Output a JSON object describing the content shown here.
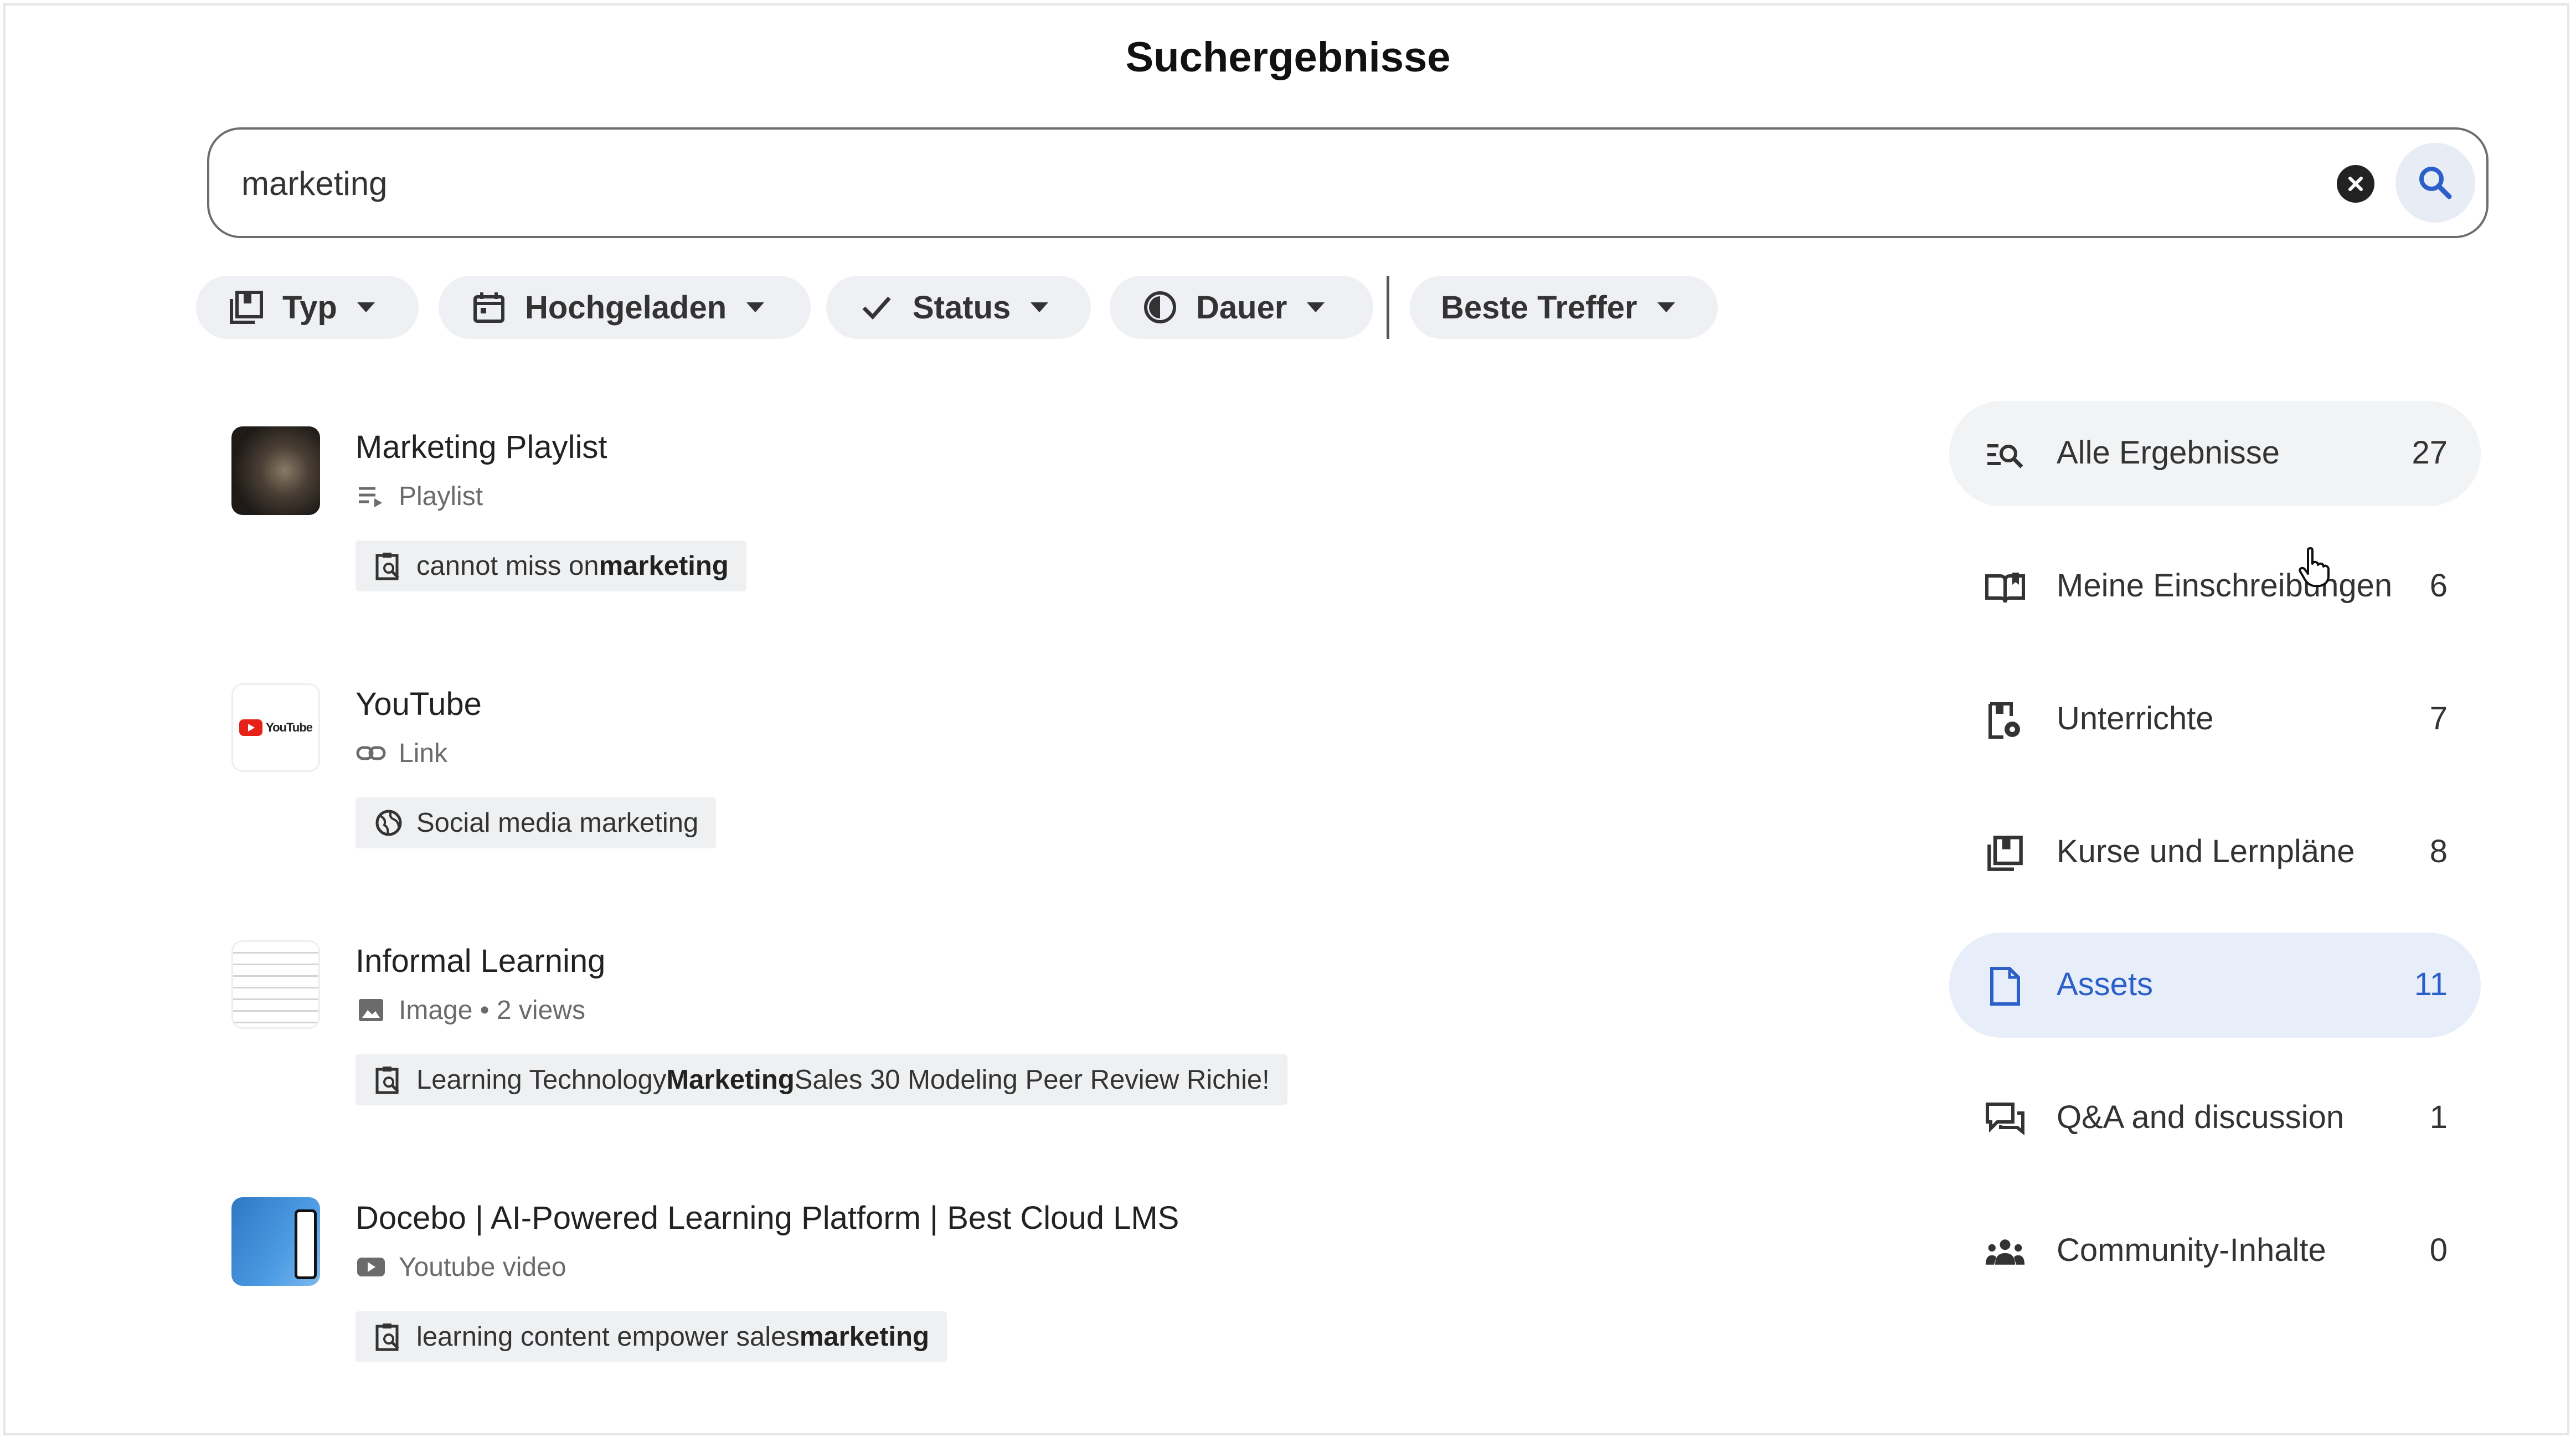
{
  "page": {
    "title": "Suchergebnisse"
  },
  "search": {
    "value": "marketing",
    "placeholder": ""
  },
  "filters": [
    {
      "label": "Typ",
      "icon": "courses-icon"
    },
    {
      "label": "Hochgeladen",
      "icon": "calendar-icon"
    },
    {
      "label": "Status",
      "icon": "check-icon"
    },
    {
      "label": "Dauer",
      "icon": "duration-icon"
    },
    {
      "label": "Beste Treffer",
      "icon": ""
    }
  ],
  "results": [
    {
      "title": "Marketing Playlist",
      "meta": "Playlist",
      "meta_icon": "playlist-icon",
      "snippet_pre": "cannot miss on ",
      "snippet_bold": "marketing",
      "snippet_post": "",
      "snippet_icon": "document-search-icon"
    },
    {
      "title": "YouTube",
      "meta": "Link",
      "meta_icon": "link-icon",
      "snippet_pre": "Social media marketing",
      "snippet_bold": "",
      "snippet_post": "",
      "snippet_icon": "globe-icon",
      "thumb_text": "YouTube"
    },
    {
      "title": "Informal Learning",
      "meta": "Image • 2 views",
      "meta_icon": "image-icon",
      "snippet_pre": "Learning Technology ",
      "snippet_bold": "Marketing",
      "snippet_post": " Sales 30 Modeling Peer Review Richie!",
      "snippet_icon": "document-search-icon"
    },
    {
      "title": "Docebo | AI-Powered Learning Platform | Best Cloud LMS",
      "meta": "Youtube video",
      "meta_icon": "youtube-video-icon",
      "snippet_pre": "learning content empower sales ",
      "snippet_bold": "marketing",
      "snippet_post": "",
      "snippet_icon": "document-search-icon"
    }
  ],
  "sidebar": [
    {
      "label": "Alle Ergebnisse",
      "count": "27",
      "icon": "search-list-icon",
      "state": "neutral"
    },
    {
      "label": "Meine Einschreibungen",
      "count": "6",
      "icon": "book-open-icon",
      "state": ""
    },
    {
      "label": "Unterrichte",
      "count": "7",
      "icon": "lesson-icon",
      "state": ""
    },
    {
      "label": "Kurse und Lernpläne",
      "count": "8",
      "icon": "courses-icon",
      "state": ""
    },
    {
      "label": "Assets",
      "count": "11",
      "icon": "file-icon",
      "state": "active"
    },
    {
      "label": "Q&A and discussion",
      "count": "1",
      "icon": "discussion-icon",
      "state": ""
    },
    {
      "label": "Community-Inhalte",
      "count": "0",
      "icon": "community-icon",
      "state": ""
    }
  ],
  "colors": {
    "accent": "#2b5fc9",
    "active_bg": "#e8eef9",
    "chip_bg": "#eef0f3"
  }
}
